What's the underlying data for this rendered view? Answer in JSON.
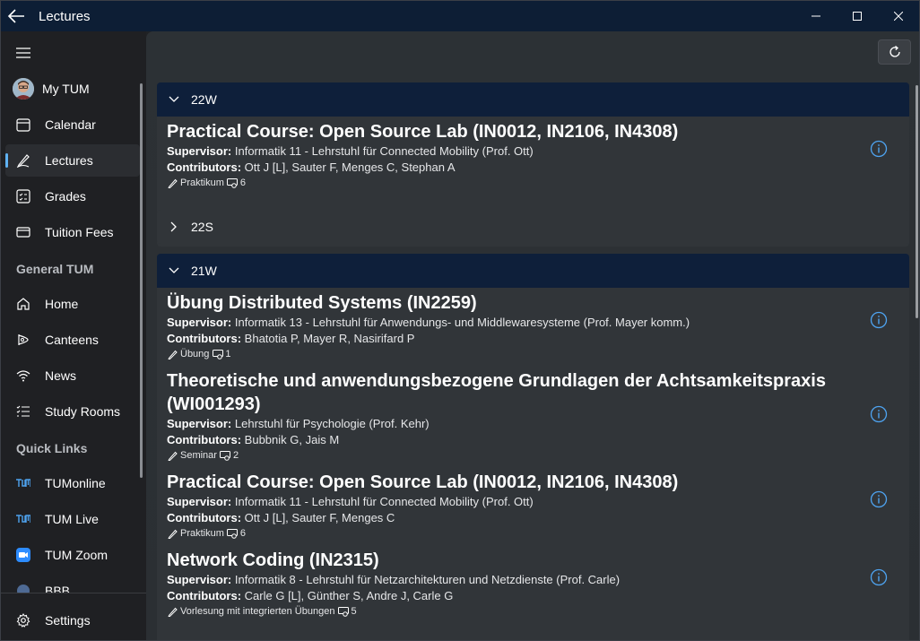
{
  "window": {
    "title": "Lectures"
  },
  "sidebar": {
    "items": [
      {
        "label": "My TUM",
        "icon": "avatar"
      },
      {
        "label": "Calendar",
        "icon": "calendar-icon"
      },
      {
        "label": "Lectures",
        "icon": "pen-icon",
        "selected": true
      },
      {
        "label": "Grades",
        "icon": "grades-icon"
      },
      {
        "label": "Tuition Fees",
        "icon": "card-icon"
      }
    ],
    "general_header": "General TUM",
    "general_items": [
      {
        "label": "Home",
        "icon": "home-icon"
      },
      {
        "label": "Canteens",
        "icon": "canteen-icon"
      },
      {
        "label": "News",
        "icon": "wifi-icon"
      },
      {
        "label": "Study Rooms",
        "icon": "list-icon"
      }
    ],
    "quick_header": "Quick Links",
    "quick_items": [
      {
        "label": "TUMonline",
        "icon": "tum-logo-icon"
      },
      {
        "label": "TUM Live",
        "icon": "tum-logo-icon"
      },
      {
        "label": "TUM Zoom",
        "icon": "zoom-icon"
      },
      {
        "label": "BBB",
        "icon": "bbb-icon"
      }
    ],
    "settings_label": "Settings",
    "accent": "#5fb2f2"
  },
  "groups": [
    {
      "label": "22W",
      "expanded": true,
      "lectures": [
        {
          "title": "Practical Course: Open Source Lab (IN0012, IN2106, IN4308)",
          "supervisor_label": "Supervisor:",
          "supervisor": "Informatik 11 - Lehrstuhl für Connected Mobility (Prof. Ott)",
          "contributors_label": "Contributors:",
          "contributors": "Ott J [L], Sauter F, Menges C, Stephan A",
          "type": "Praktikum",
          "sws": "6"
        }
      ]
    },
    {
      "label": "22S",
      "expanded": false,
      "lectures": []
    },
    {
      "label": "21W",
      "expanded": true,
      "lectures": [
        {
          "title": "Übung Distributed Systems (IN2259)",
          "supervisor_label": "Supervisor:",
          "supervisor": "Informatik 13 - Lehrstuhl für Anwendungs- und Middlewaresysteme (Prof. Mayer komm.)",
          "contributors_label": "Contributors:",
          "contributors": "Bhatotia P, Mayer R, Nasirifard P",
          "type": "Übung",
          "sws": "1"
        },
        {
          "title": "Theoretische und anwendungsbezogene Grundlagen der Achtsamkeitspraxis (WI001293)",
          "supervisor_label": "Supervisor:",
          "supervisor": "Lehrstuhl für Psychologie (Prof. Kehr)",
          "contributors_label": "Contributors:",
          "contributors": "Bubbnik G, Jais M",
          "type": "Seminar",
          "sws": "2"
        },
        {
          "title": "Practical Course: Open Source Lab (IN0012, IN2106, IN4308)",
          "supervisor_label": "Supervisor:",
          "supervisor": "Informatik 11 - Lehrstuhl für Connected Mobility (Prof. Ott)",
          "contributors_label": "Contributors:",
          "contributors": "Ott J [L], Sauter F, Menges C",
          "type": "Praktikum",
          "sws": "6"
        },
        {
          "title": "Network Coding (IN2315)",
          "supervisor_label": "Supervisor:",
          "supervisor": "Informatik 8 - Lehrstuhl für Netzarchitekturen und Netzdienste (Prof. Carle)",
          "contributors_label": "Contributors:",
          "contributors": "Carle G [L], Günther S, Andre J, Carle G",
          "type": "Vorlesung mit integrierten Übungen",
          "sws": "5"
        }
      ]
    }
  ]
}
